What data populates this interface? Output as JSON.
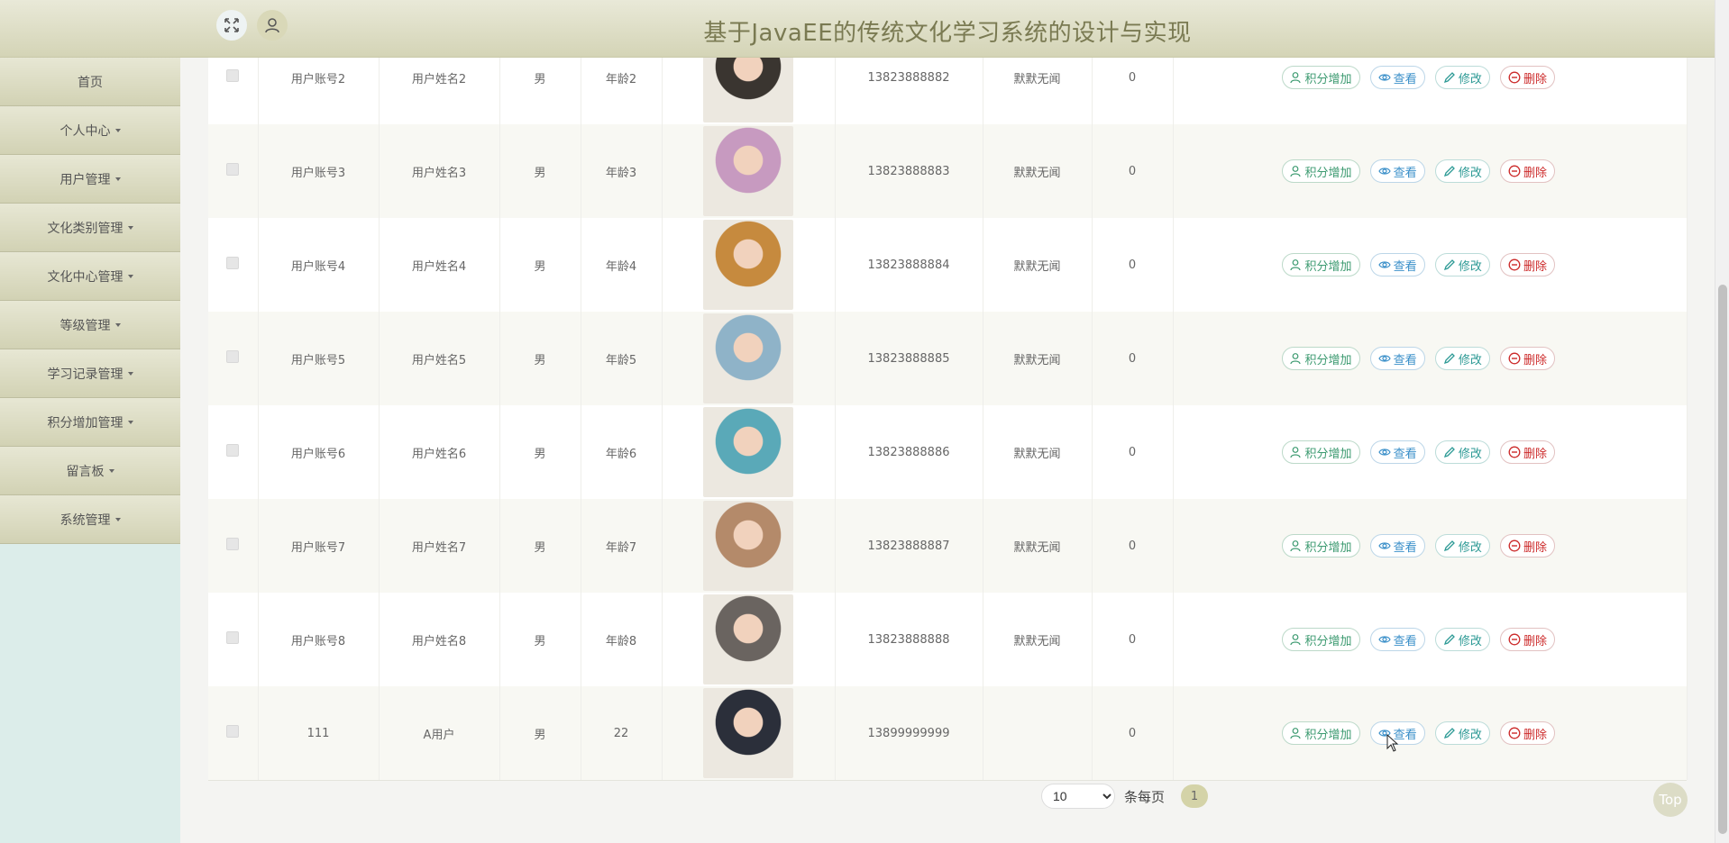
{
  "header": {
    "title": "基于JavaEE的传统文化学习系统的设计与实现"
  },
  "sidebar": {
    "items": [
      {
        "label": "首页",
        "has_caret": false
      },
      {
        "label": "个人中心",
        "has_caret": true
      },
      {
        "label": "用户管理",
        "has_caret": true
      },
      {
        "label": "文化类别管理",
        "has_caret": true
      },
      {
        "label": "文化中心管理",
        "has_caret": true
      },
      {
        "label": "等级管理",
        "has_caret": true
      },
      {
        "label": "学习记录管理",
        "has_caret": true
      },
      {
        "label": "积分增加管理",
        "has_caret": true
      },
      {
        "label": "留言板",
        "has_caret": true
      },
      {
        "label": "系统管理",
        "has_caret": true
      }
    ]
  },
  "table": {
    "actions": {
      "add": "积分增加",
      "view": "查看",
      "edit": "修改",
      "delete": "删除"
    },
    "rows": [
      {
        "account": "用户账号2",
        "name": "用户姓名2",
        "gender": "男",
        "age": "年龄2",
        "phone": "13823888882",
        "status": "默默无闻",
        "points": "0",
        "avatar_color": "#3a3530"
      },
      {
        "account": "用户账号3",
        "name": "用户姓名3",
        "gender": "男",
        "age": "年龄3",
        "phone": "13823888883",
        "status": "默默无闻",
        "points": "0",
        "avatar_color": "#c79ac0"
      },
      {
        "account": "用户账号4",
        "name": "用户姓名4",
        "gender": "男",
        "age": "年龄4",
        "phone": "13823888884",
        "status": "默默无闻",
        "points": "0",
        "avatar_color": "#c68a3e"
      },
      {
        "account": "用户账号5",
        "name": "用户姓名5",
        "gender": "男",
        "age": "年龄5",
        "phone": "13823888885",
        "status": "默默无闻",
        "points": "0",
        "avatar_color": "#8fb3c8"
      },
      {
        "account": "用户账号6",
        "name": "用户姓名6",
        "gender": "男",
        "age": "年龄6",
        "phone": "13823888886",
        "status": "默默无闻",
        "points": "0",
        "avatar_color": "#5aa9b8"
      },
      {
        "account": "用户账号7",
        "name": "用户姓名7",
        "gender": "男",
        "age": "年龄7",
        "phone": "13823888887",
        "status": "默默无闻",
        "points": "0",
        "avatar_color": "#b48a6a"
      },
      {
        "account": "用户账号8",
        "name": "用户姓名8",
        "gender": "男",
        "age": "年龄8",
        "phone": "13823888888",
        "status": "默默无闻",
        "points": "0",
        "avatar_color": "#6a6460"
      },
      {
        "account": "111",
        "name": "A用户",
        "gender": "男",
        "age": "22",
        "phone": "13899999999",
        "status": "",
        "points": "0",
        "avatar_color": "#2b2f3a"
      }
    ]
  },
  "pagination": {
    "page_size": "10",
    "page_size_options": [
      "10"
    ],
    "per_page_label": "条每页",
    "current_page": "1"
  },
  "back_to_top": "Top",
  "colors": {
    "header_bg": "#dcdcc2",
    "sidebar_bg": "#dcedea",
    "title_text": "#7a7a52",
    "delete": "#cc2a2a"
  }
}
